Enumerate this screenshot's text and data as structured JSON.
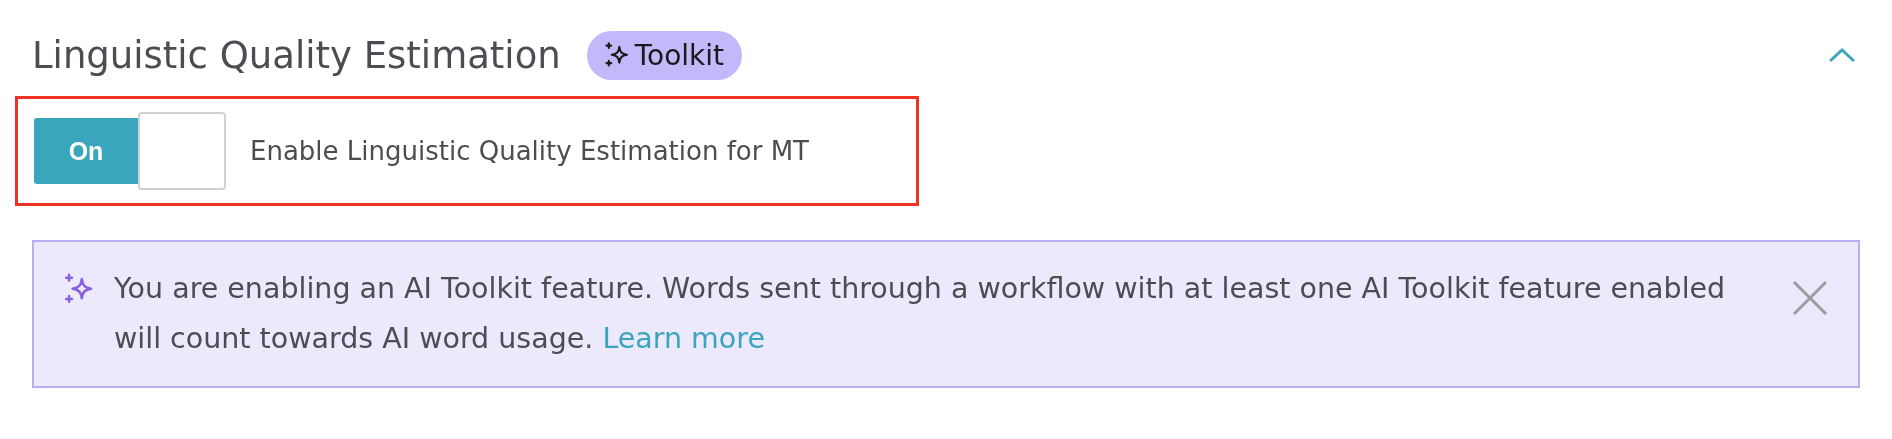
{
  "section": {
    "title": "Linguistic Quality Estimation",
    "badge": "Toolkit",
    "expanded": true
  },
  "setting": {
    "toggle_label": "On",
    "on": true,
    "label": "Enable Linguistic Quality Estimation for MT",
    "highlighted": true
  },
  "notice": {
    "text": "You are enabling an AI Toolkit feature. Words sent through a workflow with at least one AI Toolkit feature enabled will count towards AI word usage.",
    "link": "Learn more"
  }
}
